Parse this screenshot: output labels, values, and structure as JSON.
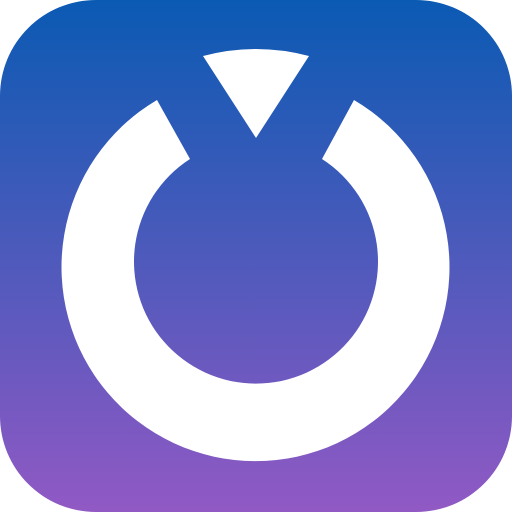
{
  "app_icon": {
    "icon": "ring-with-triangle-notch-icon",
    "colors": {
      "gradient_top": "#0a5ab3",
      "gradient_bottom": "#9159c4",
      "glyph": "#ffffff"
    }
  }
}
